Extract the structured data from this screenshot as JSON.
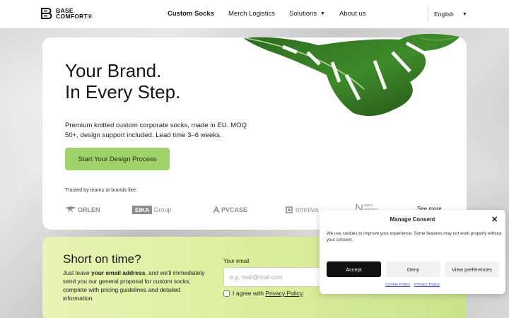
{
  "header": {
    "logo_line1": "BASE",
    "logo_line2": "COMFORT®",
    "nav": [
      {
        "label": "Custom Socks",
        "active": true
      },
      {
        "label": "Merch Logistics"
      },
      {
        "label": "Solutions",
        "has_dropdown": true
      },
      {
        "label": "About us"
      }
    ],
    "language": "English"
  },
  "hero": {
    "title": "Your Brand.\nIn Every Step.",
    "description": "Premium knitted custom corporate socks, made in EU. MOQ 50+, design support included. Lead time 3–6 weeks.",
    "cta_label": "Start Your Design Process",
    "trusted_label": "Trusted by teams at brands like:",
    "brands": {
      "orlen": "ORLEN",
      "eika_box": "EIKA",
      "eika_rest": "Group",
      "pvcase": "PVCASE",
      "omniva": "omniva",
      "nano_line1": "nano",
      "nano_line2": "avionics"
    },
    "see_more": "See more"
  },
  "short_on_time": {
    "title": "Short on time?",
    "desc_pre": "Just leave ",
    "desc_bold": "your email address",
    "desc_post": ", and we'll immediately send you our general proposal for custom socks, complete with pricing guidelines and detailed information.",
    "email_label": "Your email",
    "email_placeholder": "e.g. mail@mail.com",
    "agree_text": "I agree with ",
    "privacy_link": "Privacy Policy",
    "agree_end": "."
  },
  "consent": {
    "title": "Manage Consent",
    "text": "We use cookies to improve your experience. Some features may not work properly without your consent.",
    "accept": "Accept",
    "deny": "Deny",
    "preferences": "View preferences",
    "cookie_policy": "Cookie Policy",
    "privacy_policy": "Privacy Policy"
  },
  "colors": {
    "cta": "#9fd36a",
    "accept_bg": "#111111",
    "link": "#4a55c8"
  }
}
